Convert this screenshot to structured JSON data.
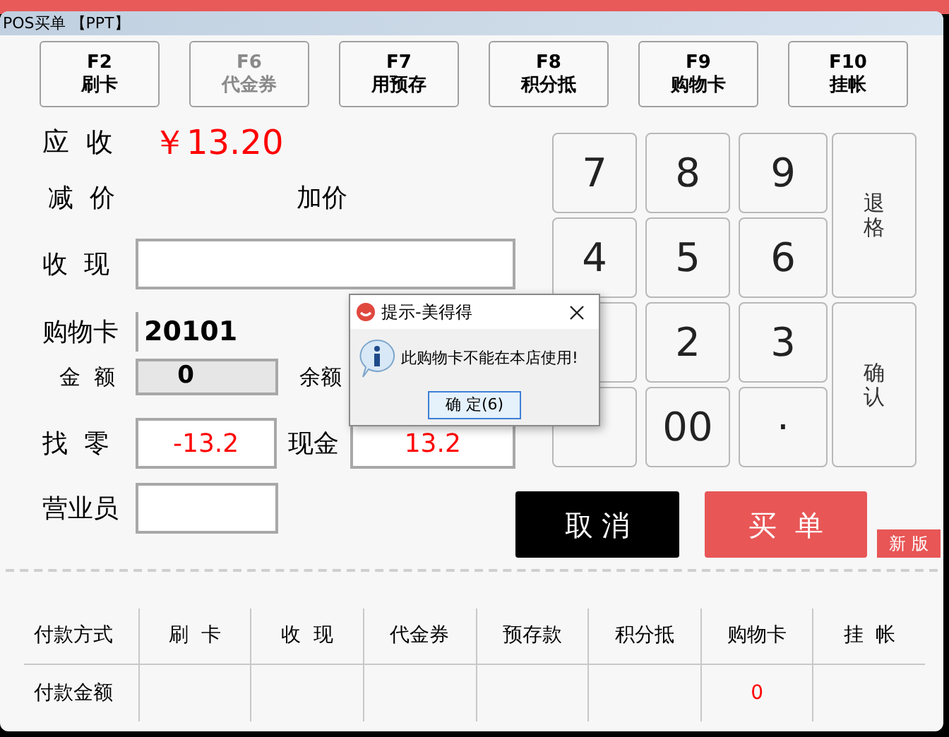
{
  "window": {
    "title": "POS买单 【PPT】"
  },
  "function_keys": [
    {
      "key": "F2",
      "label": "刷卡",
      "disabled": false
    },
    {
      "key": "F6",
      "label": "代金券",
      "disabled": true
    },
    {
      "key": "F7",
      "label": "用预存",
      "disabled": false
    },
    {
      "key": "F8",
      "label": "积分抵",
      "disabled": false
    },
    {
      "key": "F9",
      "label": "购物卡",
      "disabled": false
    },
    {
      "key": "F10",
      "label": "挂帐",
      "disabled": false
    }
  ],
  "form": {
    "due_label": "应  收",
    "due_value": "￥13.20",
    "discount_label": "减  价",
    "markup_label": "加价",
    "cash_label": "收  现",
    "card_label": "购物卡",
    "card_value": "20101",
    "amount_label": "金  额",
    "amount_value": "0",
    "balance_label": "余额",
    "change_label": "找  零",
    "change_value": "-13.2",
    "cash2_label": "现金",
    "cash2_value": "13.2",
    "clerk_label": "营业员"
  },
  "keypad": [
    "7",
    "8",
    "9",
    "4",
    "5",
    "6",
    "2",
    "3",
    "00",
    "·"
  ],
  "side_keys": [
    "退格",
    "确认"
  ],
  "buttons": {
    "cancel": "取 消",
    "pay": "买  单",
    "new_version": "新 版"
  },
  "table": {
    "columns": [
      "付款方式",
      "刷  卡",
      "收  现",
      "代金券",
      "预存款",
      "积分抵",
      "购物卡",
      "挂  帐"
    ],
    "rows": [
      [
        "付款金额",
        "",
        "",
        "",
        "",
        "",
        "0",
        ""
      ]
    ]
  },
  "dialog": {
    "title": "提示-美得得",
    "message": "此购物卡不能在本店使用!",
    "button": "确 定(6)"
  }
}
